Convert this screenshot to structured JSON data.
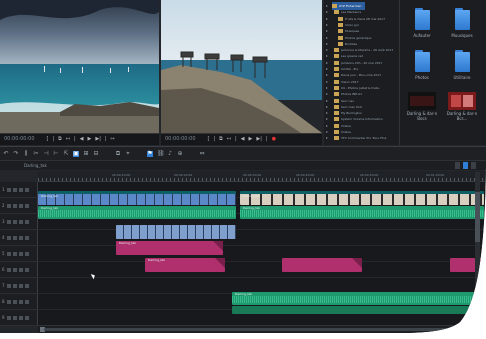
{
  "preview_left": {
    "timecode": "00:00:00:00",
    "controls": [
      "[",
      "|",
      "⧉",
      "↤",
      "|",
      "◀",
      "▶",
      "▶|",
      "|",
      "↦"
    ]
  },
  "preview_right": {
    "timecode": "00:00:00:00",
    "controls": [
      "[",
      "|",
      "⧉",
      "↤",
      "|",
      "◀",
      "▶",
      "▶|",
      "|",
      "●"
    ]
  },
  "explorer": {
    "tree": [
      {
        "label": "XYZ Fisherman",
        "selected": true
      },
      {
        "label": "Les Planteurs",
        "selected": false
      },
      {
        "label": "Fruits & Dans  08 mai 2017",
        "selected": false
      },
      {
        "label": "Volvo gol",
        "selected": false
      },
      {
        "label": "Musiques",
        "selected": false
      },
      {
        "label": "Photos générique",
        "selected": false
      },
      {
        "label": "Buddies",
        "selected": false
      },
      {
        "label": "Jamonne & Maxime - 26 août 2017",
        "selected": false
      },
      {
        "label": "Les greens red",
        "selected": false
      },
      {
        "label": "Jambons 24h - 20 mai 2017",
        "selected": false
      },
      {
        "label": "Amitié - Eui",
        "selected": false
      },
      {
        "label": "Devis juin  - Plus-ome 2017",
        "selected": false
      },
      {
        "label": "Vision 2017",
        "selected": false
      },
      {
        "label": "04 - Photos Juillet & Dubu",
        "selected": false
      },
      {
        "label": "Photos INE-01",
        "selected": false
      },
      {
        "label": "Sarc nao",
        "selected": false
      },
      {
        "label": "Sarc man 610",
        "selected": false
      },
      {
        "label": "My Burlington",
        "selected": false
      },
      {
        "label": "System Volume Information",
        "selected": false
      },
      {
        "label": "Vidéos",
        "selected": false
      },
      {
        "label": "Vidéos",
        "selected": false
      },
      {
        "label": "VFC Commenter Pro Tous Titul",
        "selected": false
      }
    ],
    "tiles": [
      {
        "type": "folder",
        "label": "Aufauter"
      },
      {
        "type": "folder",
        "label": "Muusiques"
      },
      {
        "type": "folder",
        "label": "Photos"
      },
      {
        "type": "folder",
        "label": "Utilitaire"
      },
      {
        "type": "video",
        "label": "Darling & dar-n Bocs"
      },
      {
        "type": "video",
        "label": "Darling & dar-n Bcs..."
      }
    ]
  },
  "toolbar": {
    "icons": [
      "undo-icon",
      "redo-icon",
      "split-icon",
      "cut-icon",
      "trim-icon",
      "razor-icon",
      "pointer-icon",
      "select-icon",
      "insert-icon",
      "overwrite-icon",
      "group-icon",
      "snap-icon",
      "marker-icon",
      "link-icon",
      "audio-icon",
      "zoom-icon",
      "fit-icon"
    ]
  },
  "project_tab": "Darling_tak",
  "ruler": {
    "labels": [
      "00:00:00:00",
      "00:00:10:00",
      "00:00:20:00",
      "00:00:30:00",
      "00:00:40:00",
      "00:00:50:00",
      "00:01:00:00"
    ],
    "center": "00:00:30:00"
  },
  "tracks": [
    {
      "label": "1"
    },
    {
      "label": "2"
    },
    {
      "label": "3"
    },
    {
      "label": "4"
    },
    {
      "label": "5"
    },
    {
      "label": "6"
    },
    {
      "label": "7"
    },
    {
      "label": "8"
    },
    {
      "label": "9"
    }
  ],
  "clips": {
    "v1a": "Darling_tak",
    "v1b": "Darling_tak",
    "a1a": "Darling_tak",
    "a1b": "Darling_tak",
    "a3": "Darling_tak",
    "t5": "Darling_tak",
    "t8": "Darling_tak"
  },
  "colors": {
    "accent": "#2f7fd6",
    "video": "#1c8a93",
    "audio": "#1e9a6e",
    "title": "#b0306e"
  }
}
